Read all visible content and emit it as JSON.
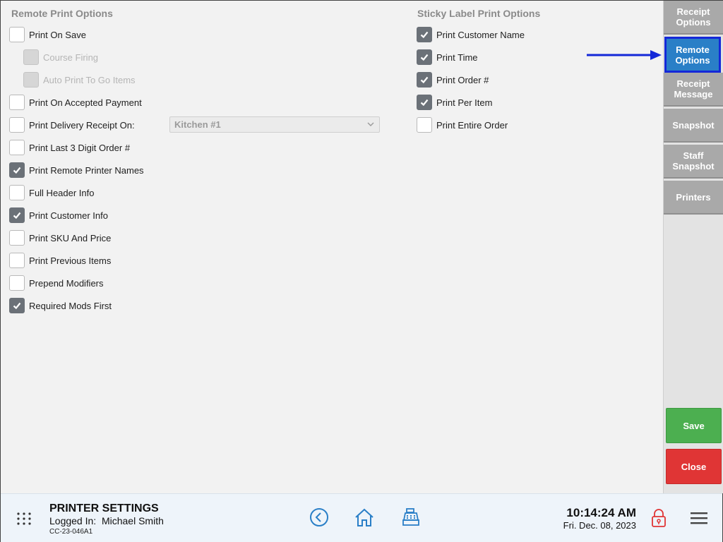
{
  "remote": {
    "title": "Remote Print Options",
    "items": [
      {
        "label": "Print On Save",
        "checked": false,
        "disabled": false
      },
      {
        "label": "Course Firing",
        "checked": false,
        "disabled": true
      },
      {
        "label": "Auto Print To Go Items",
        "checked": false,
        "disabled": true
      },
      {
        "label": "Print On Accepted Payment",
        "checked": false,
        "disabled": false
      },
      {
        "label": "Print Delivery Receipt On:",
        "checked": false,
        "disabled": false
      },
      {
        "label": "Print Last 3 Digit Order #",
        "checked": false,
        "disabled": false
      },
      {
        "label": "Print Remote Printer Names",
        "checked": true,
        "disabled": false
      },
      {
        "label": "Full Header Info",
        "checked": false,
        "disabled": false
      },
      {
        "label": "Print Customer Info",
        "checked": true,
        "disabled": false
      },
      {
        "label": "Print SKU And Price",
        "checked": false,
        "disabled": false
      },
      {
        "label": "Print Previous Items",
        "checked": false,
        "disabled": false
      },
      {
        "label": "Prepend Modifiers",
        "checked": false,
        "disabled": false
      },
      {
        "label": "Required Mods First",
        "checked": true,
        "disabled": false
      }
    ],
    "delivery_printer": "Kitchen #1"
  },
  "sticky": {
    "title": "Sticky Label Print Options",
    "items": [
      {
        "label": "Print Customer Name",
        "checked": true
      },
      {
        "label": "Print Time",
        "checked": true
      },
      {
        "label": "Print Order #",
        "checked": true
      },
      {
        "label": "Print Per Item",
        "checked": true
      },
      {
        "label": "Print Entire Order",
        "checked": false
      }
    ]
  },
  "sidebar": {
    "items": [
      {
        "label": "Receipt Options",
        "active": false
      },
      {
        "label": "Remote Options",
        "active": true
      },
      {
        "label": "Receipt Message",
        "active": false
      },
      {
        "label": "Snapshot",
        "active": false
      },
      {
        "label": "Staff Snapshot",
        "active": false
      },
      {
        "label": "Printers",
        "active": false
      }
    ],
    "save_label": "Save",
    "close_label": "Close"
  },
  "footer": {
    "title": "PRINTER SETTINGS",
    "logged_in_label": "Logged In:",
    "user": "Michael Smith",
    "station_code": "CC-23-046A1",
    "time": "10:14:24 AM",
    "date": "Fri. Dec. 08, 2023"
  },
  "colors": {
    "accent_blue": "#2a7fc7",
    "highlight": "#1428d8",
    "save_green": "#4caf50",
    "close_red": "#e03535",
    "check_gray": "#6b7178"
  }
}
